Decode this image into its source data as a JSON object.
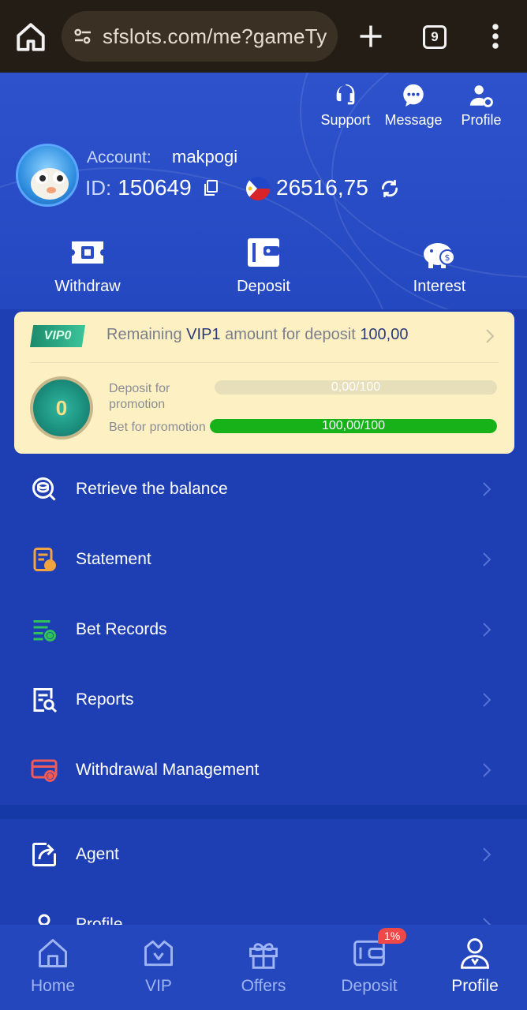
{
  "browser": {
    "url": "sfslots.com/me?gameTy",
    "tab_count": "9"
  },
  "header": {
    "support_label": "Support",
    "message_label": "Message",
    "profile_label": "Profile",
    "account_label": "Account:",
    "account_name": "makpogi",
    "id_label": "ID:",
    "id_value": "150649",
    "balance": "26516,75"
  },
  "actions": {
    "withdraw": "Withdraw",
    "deposit": "Deposit",
    "interest": "Interest"
  },
  "vip": {
    "badge": "VIP0",
    "remaining_prefix": "Remaining",
    "remaining_level": "VIP1",
    "remaining_middle": "amount for deposit",
    "remaining_amount": "100,00",
    "coin_level": "0",
    "deposit_label": "Deposit for promotion",
    "deposit_progress_text": "0,00/100",
    "deposit_progress": 0,
    "bet_label": "Bet for promotion",
    "bet_progress_text": "100,00/100",
    "bet_progress": 1
  },
  "menu": [
    {
      "label": "Retrieve the balance"
    },
    {
      "label": "Statement"
    },
    {
      "label": "Bet Records"
    },
    {
      "label": "Reports"
    },
    {
      "label": "Withdrawal Management"
    },
    {
      "label": "Agent"
    },
    {
      "label": "Profile"
    }
  ],
  "nav": {
    "home": "Home",
    "vip": "VIP",
    "offers": "Offers",
    "deposit": "Deposit",
    "deposit_badge": "1%",
    "profile": "Profile"
  },
  "colors": {
    "background": "#1e3fb3",
    "card": "#fdf0c2",
    "progress_green": "#17b21a",
    "badge_red": "#f04848"
  }
}
